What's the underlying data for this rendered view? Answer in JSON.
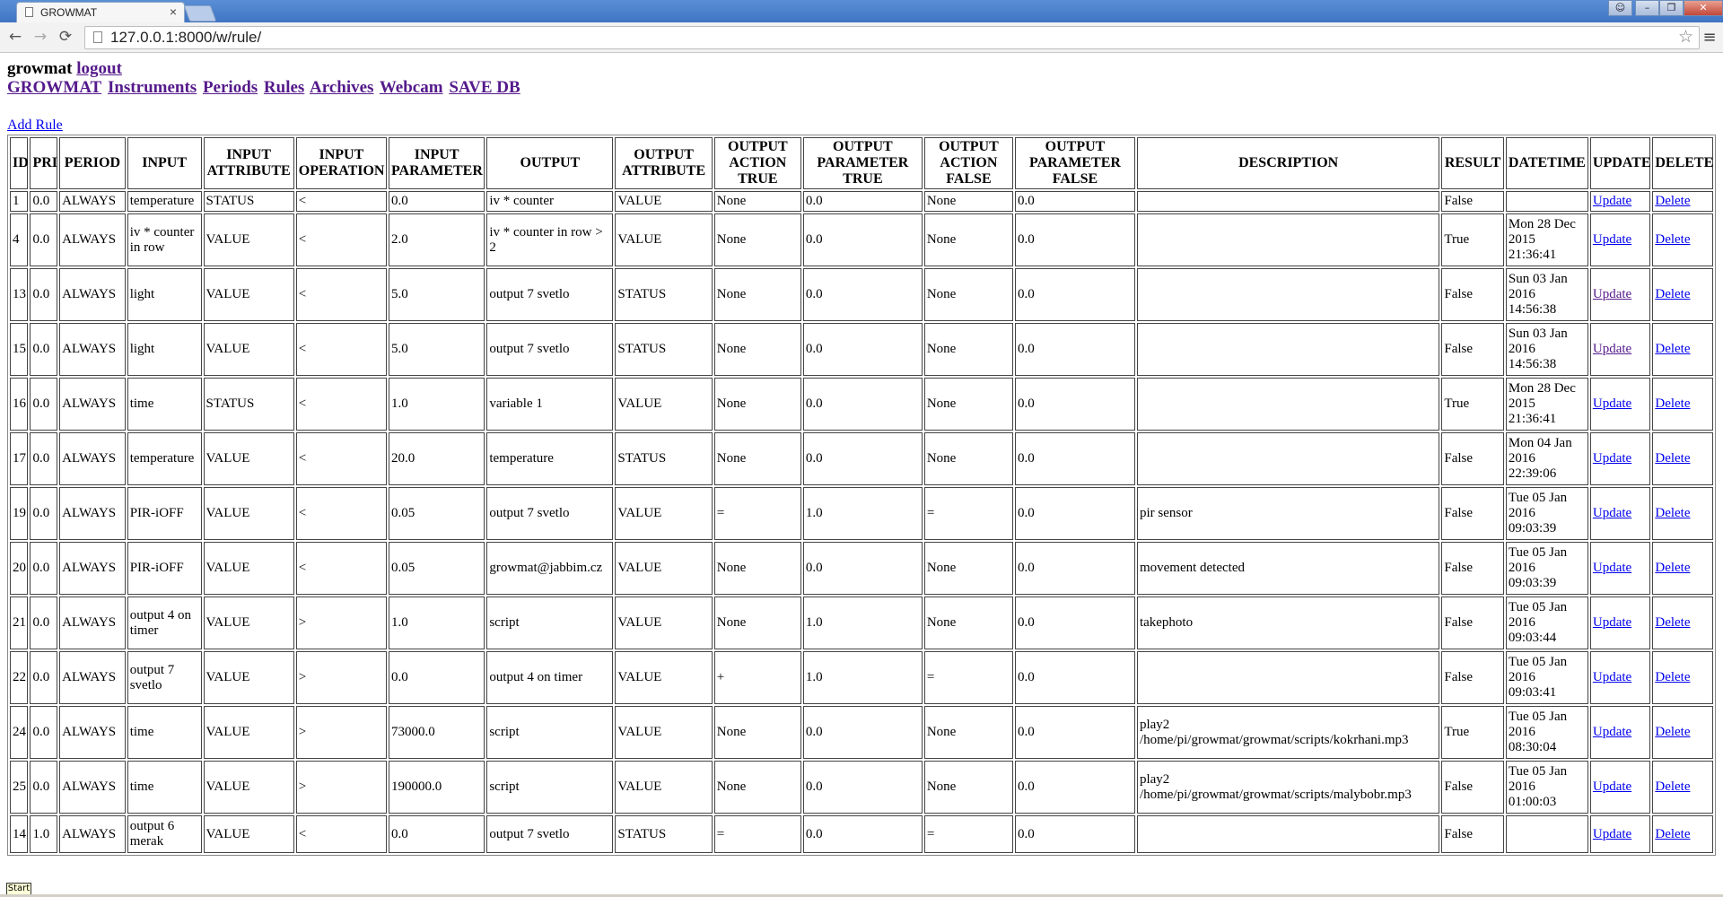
{
  "browser": {
    "tab_title": "GROWMAT",
    "tab_close": "×",
    "url": "127.0.0.1:8000/w/rule/",
    "back": "←",
    "forward": "→",
    "reload": "⟳",
    "star": "☆",
    "menu": "≡"
  },
  "header": {
    "site_name": "growmat",
    "logout": "logout"
  },
  "nav": [
    "GROWMAT",
    "Instruments",
    "Periods",
    "Rules",
    "Archives",
    "Webcam",
    "SAVE DB"
  ],
  "add_rule": "Add Rule",
  "table": {
    "columns": [
      "ID",
      "PRI",
      "PERIOD",
      "INPUT",
      "INPUT ATTRIBUTE",
      "INPUT OPERATION",
      "INPUT PARAMETER",
      "OUTPUT",
      "OUTPUT ATTRIBUTE",
      "OUTPUT ACTION TRUE",
      "OUTPUT PARAMETER TRUE",
      "OUTPUT ACTION FALSE",
      "OUTPUT PARAMETER FALSE",
      "DESCRIPTION",
      "RESULT",
      "DATETIME",
      "UPDATE",
      "DELETE"
    ],
    "rows": [
      [
        "1",
        "0.0",
        "ALWAYS",
        "temperature",
        "STATUS",
        "<",
        "0.0",
        "iv * counter",
        "VALUE",
        "None",
        "0.0",
        "None",
        "0.0",
        "",
        "False",
        "",
        "Update",
        "Delete"
      ],
      [
        "4",
        "0.0",
        "ALWAYS",
        "iv * counter in row",
        "VALUE",
        "<",
        "2.0",
        "iv * counter in row > 2",
        "VALUE",
        "None",
        "0.0",
        "None",
        "0.0",
        "",
        "True",
        "Mon 28 Dec 2015 21:36:41",
        "Update",
        "Delete"
      ],
      [
        "13",
        "0.0",
        "ALWAYS",
        "light",
        "VALUE",
        "<",
        "5.0",
        "output 7 svetlo",
        "STATUS",
        "None",
        "0.0",
        "None",
        "0.0",
        "",
        "False",
        "Sun 03 Jan 2016 14:56:38",
        "Update",
        "Delete"
      ],
      [
        "15",
        "0.0",
        "ALWAYS",
        "light",
        "VALUE",
        "<",
        "5.0",
        "output 7 svetlo",
        "STATUS",
        "None",
        "0.0",
        "None",
        "0.0",
        "",
        "False",
        "Sun 03 Jan 2016 14:56:38",
        "Update",
        "Delete"
      ],
      [
        "16",
        "0.0",
        "ALWAYS",
        "time",
        "STATUS",
        "<",
        "1.0",
        "variable 1",
        "VALUE",
        "None",
        "0.0",
        "None",
        "0.0",
        "",
        "True",
        "Mon 28 Dec 2015 21:36:41",
        "Update",
        "Delete"
      ],
      [
        "17",
        "0.0",
        "ALWAYS",
        "temperature",
        "VALUE",
        "<",
        "20.0",
        "temperature",
        "STATUS",
        "None",
        "0.0",
        "None",
        "0.0",
        "",
        "False",
        "Mon 04 Jan 2016 22:39:06",
        "Update",
        "Delete"
      ],
      [
        "19",
        "0.0",
        "ALWAYS",
        "PIR-iOFF",
        "VALUE",
        "<",
        "0.05",
        "output 7 svetlo",
        "VALUE",
        "=",
        "1.0",
        "=",
        "0.0",
        "pir sensor",
        "False",
        "Tue 05 Jan 2016 09:03:39",
        "Update",
        "Delete"
      ],
      [
        "20",
        "0.0",
        "ALWAYS",
        "PIR-iOFF",
        "VALUE",
        "<",
        "0.05",
        "growmat@jabbim.cz",
        "VALUE",
        "None",
        "0.0",
        "None",
        "0.0",
        "movement detected",
        "False",
        "Tue 05 Jan 2016 09:03:39",
        "Update",
        "Delete"
      ],
      [
        "21",
        "0.0",
        "ALWAYS",
        "output 4 on timer",
        "VALUE",
        ">",
        "1.0",
        "script",
        "VALUE",
        "None",
        "1.0",
        "None",
        "0.0",
        "takephoto",
        "False",
        "Tue 05 Jan 2016 09:03:44",
        "Update",
        "Delete"
      ],
      [
        "22",
        "0.0",
        "ALWAYS",
        "output 7 svetlo",
        "VALUE",
        ">",
        "0.0",
        "output 4 on timer",
        "VALUE",
        "+",
        "1.0",
        "=",
        "0.0",
        "",
        "False",
        "Tue 05 Jan 2016 09:03:41",
        "Update",
        "Delete"
      ],
      [
        "24",
        "0.0",
        "ALWAYS",
        "time",
        "VALUE",
        ">",
        "73000.0",
        "script",
        "VALUE",
        "None",
        "0.0",
        "None",
        "0.0",
        "play2 /home/pi/growmat/growmat/scripts/kokrhani.mp3",
        "True",
        "Tue 05 Jan 2016 08:30:04",
        "Update",
        "Delete"
      ],
      [
        "25",
        "0.0",
        "ALWAYS",
        "time",
        "VALUE",
        ">",
        "190000.0",
        "script",
        "VALUE",
        "None",
        "0.0",
        "None",
        "0.0",
        "play2 /home/pi/growmat/growmat/scripts/malybobr.mp3",
        "False",
        "Tue 05 Jan 2016 01:00:03",
        "Update",
        "Delete"
      ],
      [
        "14",
        "1.0",
        "ALWAYS",
        "output 6 merak",
        "VALUE",
        "<",
        "0.0",
        "output 7 svetlo",
        "STATUS",
        "=",
        "0.0",
        "=",
        "0.0",
        "",
        "False",
        "",
        "Update",
        "Delete"
      ]
    ]
  },
  "start_button": "Start"
}
